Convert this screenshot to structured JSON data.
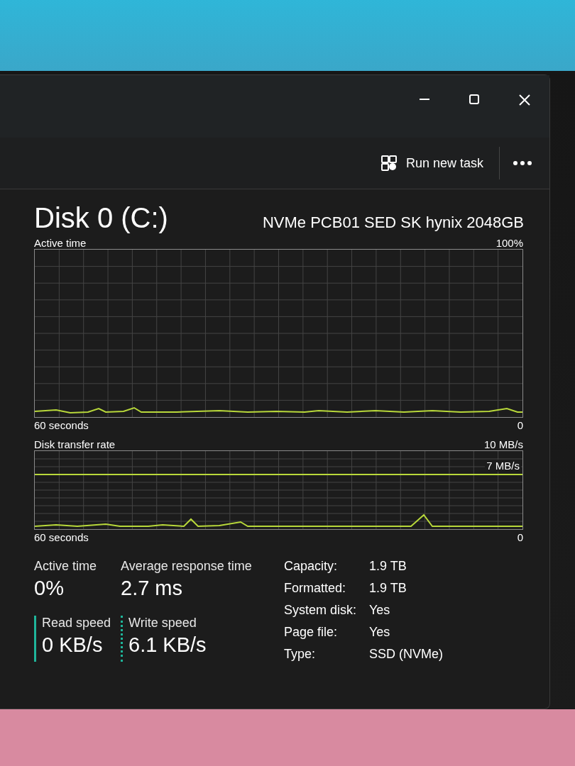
{
  "toolbar": {
    "run_new_task": "Run new task"
  },
  "disk": {
    "title": "Disk 0 (C:)",
    "model": "NVMe PCB01 SED SK hynix 2048GB"
  },
  "graphs": [
    {
      "label": "Active time",
      "max": "100%",
      "time_span": "60 seconds",
      "min": "0"
    },
    {
      "label": "Disk transfer rate",
      "max": "10 MB/s",
      "line_label": "7 MB/s",
      "time_span": "60 seconds",
      "min": "0"
    }
  ],
  "stats": [
    {
      "kind": "plain",
      "label": "Active time",
      "value": "0%"
    },
    {
      "kind": "plain",
      "label": "Average response time",
      "value": "2.7 ms"
    },
    {
      "kind": "read",
      "label": "Read speed",
      "value": "0 KB/s"
    },
    {
      "kind": "write",
      "label": "Write speed",
      "value": "6.1 KB/s"
    }
  ],
  "properties": [
    {
      "label": "Capacity:",
      "value": "1.9 TB"
    },
    {
      "label": "Formatted:",
      "value": "1.9 TB"
    },
    {
      "label": "System disk:",
      "value": "Yes"
    },
    {
      "label": "Page file:",
      "value": "Yes"
    },
    {
      "label": "Type:",
      "value": "SSD (NVMe)"
    }
  ]
}
